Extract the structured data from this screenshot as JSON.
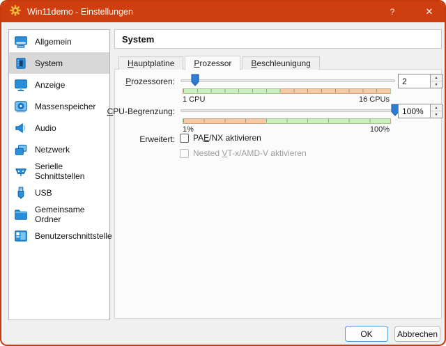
{
  "window": {
    "title": "Win11demo - Einstellungen",
    "help_label": "?",
    "close_label": "✕"
  },
  "colors": {
    "titlebar-bg": "#cf3e0e",
    "window-border": "#c63b0e",
    "handle-blue": "#2e7bd4",
    "ok-green": "#c9f0bc",
    "warn-orange": "#f5c9a4",
    "selection-bg": "#d8d8d8"
  },
  "sidebar": {
    "items": [
      {
        "label": "Allgemein"
      },
      {
        "label": "System"
      },
      {
        "label": "Anzeige"
      },
      {
        "label": "Massenspeicher"
      },
      {
        "label": "Audio"
      },
      {
        "label": "Netzwerk"
      },
      {
        "label": "Serielle Schnittstellen"
      },
      {
        "label": "USB"
      },
      {
        "label": "Gemeinsame Ordner"
      },
      {
        "label": "Benutzerschnittstelle"
      }
    ]
  },
  "header": {
    "title": "System"
  },
  "tabs": [
    {
      "key": "H",
      "rest": "auptplatine"
    },
    {
      "key": "P",
      "rest": "rozessor"
    },
    {
      "key": "B",
      "rest": "eschleunigung"
    }
  ],
  "processor": {
    "label_key": "P",
    "label_rest": "rozessoren:",
    "value": "2",
    "scale_min": "1 CPU",
    "scale_max": "16 CPUs",
    "slider_pos_pct": 6.7,
    "green_pct": 47,
    "segments": 15
  },
  "cpu_cap": {
    "label_key": "C",
    "label_rest": "PU-Begrenzung:",
    "value": "100%",
    "scale_min": "1%",
    "scale_max": "100%",
    "slider_pos_pct": 100,
    "orange_pct": 40,
    "segments": 10
  },
  "advanced": {
    "label": "Erweitert:",
    "pae": {
      "pre": "PA",
      "key": "E",
      "rest": "/NX aktivieren",
      "checked": false,
      "disabled": false
    },
    "nested": {
      "pre": "Nested ",
      "key": "V",
      "rest": "T-x/AMD-V aktivieren",
      "checked": false,
      "disabled": true
    }
  },
  "footer": {
    "ok": "OK",
    "cancel": "Abbrechen"
  }
}
